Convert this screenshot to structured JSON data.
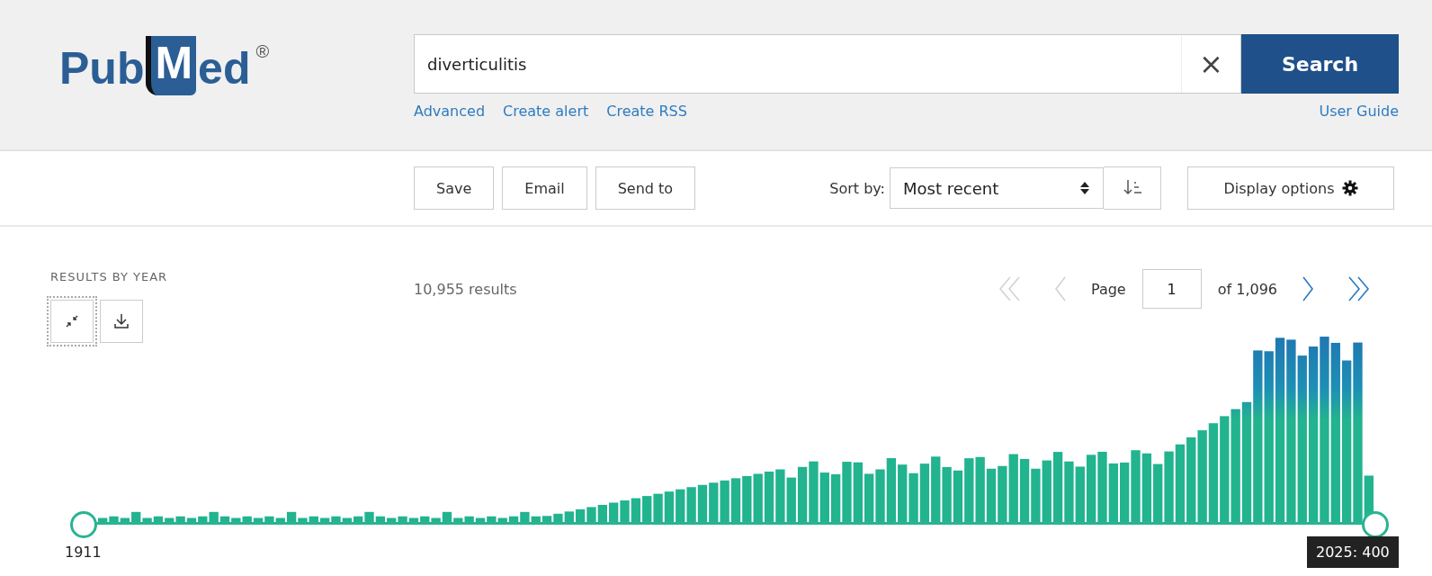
{
  "logo": {
    "before": "Pub",
    "on_book": "M",
    "after": "ed",
    "mark": "®"
  },
  "search": {
    "value": "diverticulitis",
    "clear": "×",
    "button": "Search"
  },
  "search_links": [
    "Advanced",
    "Create alert",
    "Create RSS"
  ],
  "user_guide": "User Guide",
  "actions": [
    "Save",
    "Email",
    "Send to"
  ],
  "sort": {
    "label": "Sort by:",
    "value": "Most recent"
  },
  "display_options": "Display options",
  "results_by_year": {
    "title": "RESULTS BY YEAR",
    "start_label": "1911",
    "tooltip": "2025: 400"
  },
  "results_count": "10,955 results",
  "pagination": {
    "first": {
      "disabled": true
    },
    "previous": {
      "disabled": true
    },
    "page_label": "Page",
    "page": "1",
    "of": "of 1,096",
    "next": {
      "disabled": false
    },
    "last": {
      "disabled": false
    }
  }
}
